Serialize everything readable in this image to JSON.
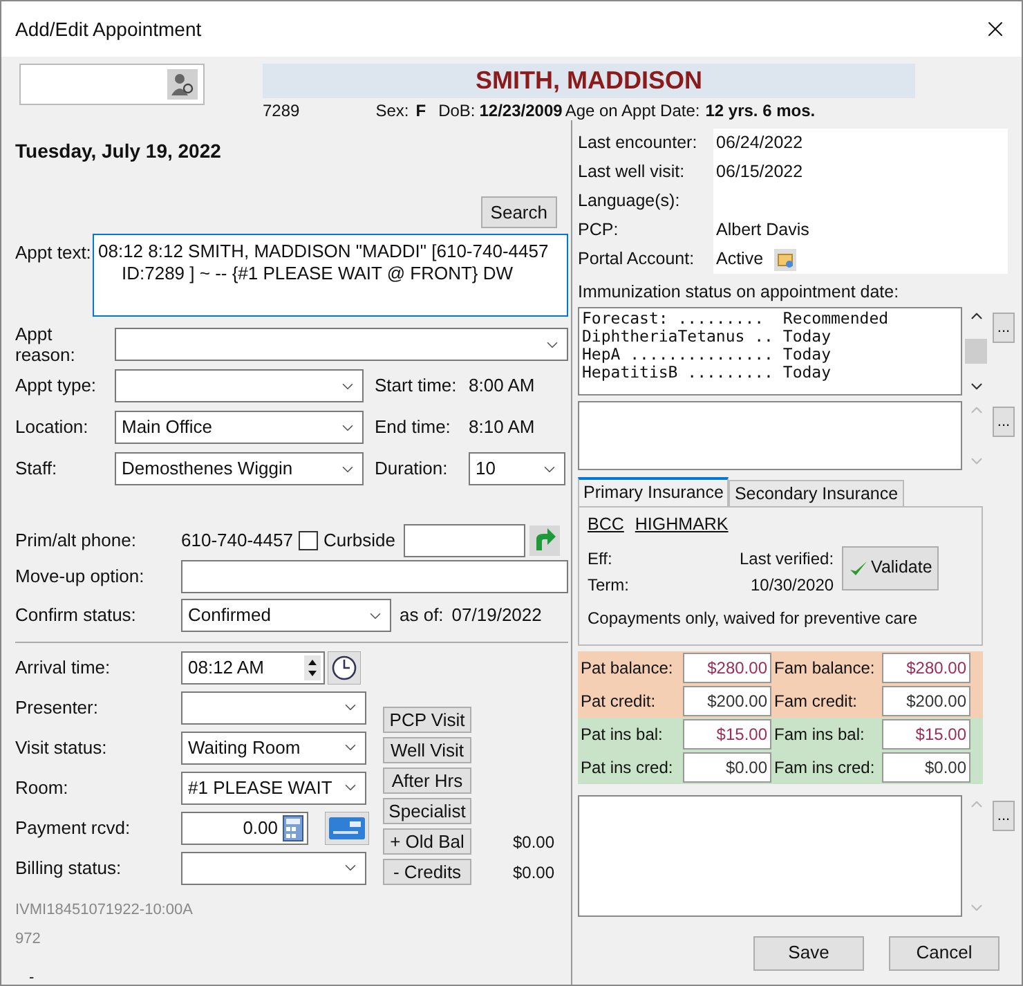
{
  "window": {
    "title": "Add/Edit Appointment"
  },
  "patient": {
    "name": "SMITH, MADDISON",
    "id": "7289",
    "sex_label": "Sex:",
    "sex": "F",
    "dob_label": "DoB:",
    "dob": "12/23/2009",
    "age_label": "Age on Appt Date:",
    "age": "12 yrs. 6 mos."
  },
  "date": "Tuesday, July 19, 2022",
  "search_button": "Search",
  "appt_text": {
    "label": "Appt text:",
    "value": "08:12 8:12 SMITH, MADDISON \"MADDI\" [610-740-4457 ID:7289 ] ~ -- {#1 PLEASE WAIT @ FRONT} DW"
  },
  "appt_reason": {
    "label": "Appt reason:"
  },
  "schedule_rows": [
    {
      "label": "Appt type:",
      "side": {
        "label": "Start time:",
        "value": "8:00 AM",
        "kind": "text"
      }
    },
    {
      "label": "Location:",
      "value": "Main Office",
      "side": {
        "label": "End time:",
        "value": "8:10 AM",
        "kind": "text"
      }
    },
    {
      "label": "Staff:",
      "value": "Demosthenes Wiggin",
      "side": {
        "label": "Duration:",
        "value": "10",
        "kind": "dropdown"
      }
    }
  ],
  "phone": {
    "label": "Prim/alt phone:",
    "value": "610-740-4457"
  },
  "curbside": {
    "label": "Curbside",
    "checked": false
  },
  "move_up": {
    "label": "Move-up option:"
  },
  "confirm": {
    "label": "Confirm status:",
    "value": "Confirmed",
    "as_of_label": "as of:",
    "as_of": "07/19/2022"
  },
  "arrival": {
    "label": "Arrival time:",
    "value": "08:12 AM"
  },
  "visit_rows": [
    {
      "label": "Presenter:",
      "kind": "dropdown"
    },
    {
      "label": "Visit status:",
      "kind": "dropdown",
      "value": "Waiting Room"
    },
    {
      "label": "Room:",
      "kind": "dropdown",
      "value": "#1 PLEASE WAIT"
    },
    {
      "label": "Payment rcvd:",
      "kind": "money",
      "value": "0.00"
    },
    {
      "label": "Billing status:",
      "kind": "dropdown"
    }
  ],
  "visit_buttons": [
    {
      "label": "PCP Visit"
    },
    {
      "label": "Well Visit"
    },
    {
      "label": "After Hrs"
    },
    {
      "label": "Specialist"
    },
    {
      "label": "+ Old Bal",
      "amount": "$0.00"
    },
    {
      "label": "- Credits",
      "amount": "$0.00"
    }
  ],
  "footer_codes": [
    "IVMI18451071922-10:00A",
    "972",
    "-"
  ],
  "summary": [
    {
      "label": "Last encounter:",
      "value": "06/24/2022",
      "kind": "text"
    },
    {
      "label": "Last well visit:",
      "value": "06/15/2022",
      "kind": "text"
    },
    {
      "label": "Language(s):",
      "kind": "text"
    },
    {
      "label": "PCP:",
      "value": "Albert Davis",
      "kind": "text"
    },
    {
      "label": "Portal Account:",
      "value": "Active",
      "kind": "portal"
    }
  ],
  "immunization": {
    "label": "Immunization status on appointment date:",
    "lines": [
      "Forecast: .........  Recommended",
      "DiphtheriaTetanus .. Today",
      "HepA ............... Today",
      "HepatitisB ......... Today"
    ]
  },
  "more_button": "...",
  "insurance_tabs": [
    {
      "label": "Primary Insurance",
      "selected": true
    },
    {
      "label": "Secondary Insurance",
      "selected": false
    }
  ],
  "insurance": {
    "carriers": [
      "BCC",
      "HIGHMARK"
    ],
    "eff_label": "Eff:",
    "term_label": "Term:",
    "verified_label": "Last verified:",
    "verified": "10/30/2020",
    "validate_button": "Validate",
    "note": "Copayments only, waived for preventive care"
  },
  "balances": [
    {
      "color": "#f4cfb4",
      "cells": [
        {
          "label": "Pat balance:",
          "value": "$280.00",
          "color": "#9b2d55"
        },
        {
          "label": "Fam balance:",
          "value": "$280.00",
          "color": "#9b2d55"
        }
      ]
    },
    {
      "color": "#f4cfb4",
      "cells": [
        {
          "label": "Pat credit:",
          "value": "$200.00",
          "color": "#333333"
        },
        {
          "label": "Fam credit:",
          "value": "$200.00",
          "color": "#333333"
        }
      ]
    },
    {
      "color": "#c9e3c8",
      "cells": [
        {
          "label": "Pat ins bal:",
          "value": "$15.00",
          "color": "#9b2d55"
        },
        {
          "label": "Fam ins bal:",
          "value": "$15.00",
          "color": "#9b2d55"
        }
      ]
    },
    {
      "color": "#c9e3c8",
      "cells": [
        {
          "label": "Pat ins cred:",
          "value": "$0.00",
          "color": "#333333"
        },
        {
          "label": "Fam ins cred:",
          "value": "$0.00",
          "color": "#333333"
        }
      ]
    }
  ],
  "buttons": [
    {
      "label": "Save"
    },
    {
      "label": "Cancel"
    }
  ]
}
